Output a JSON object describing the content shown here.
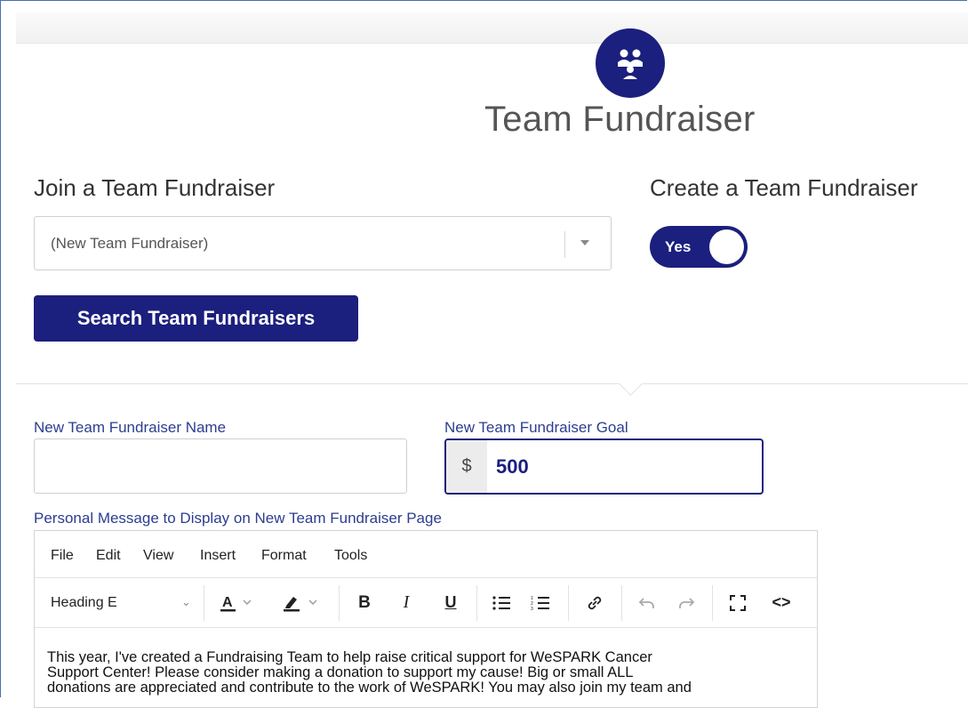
{
  "page": {
    "title": "Team Fundraiser",
    "icon": "team-icon"
  },
  "join": {
    "heading": "Join a Team Fundraiser",
    "select_value": "(New Team Fundraiser)",
    "search_button": "Search Team Fundraisers"
  },
  "create": {
    "heading": "Create a Team Fundraiser",
    "toggle_label": "Yes",
    "toggle_on": true
  },
  "form": {
    "name_label": "New Team Fundraiser Name",
    "name_value": "",
    "goal_label": "New Team Fundraiser Goal",
    "goal_prefix": "$",
    "goal_value": "500",
    "message_label": "Personal Message to Display on New Team Fundraiser Page"
  },
  "editor": {
    "menu": [
      "File",
      "Edit",
      "View",
      "Insert",
      "Format",
      "Tools"
    ],
    "format_select": "Heading E",
    "content_lines": [
      "This year, I've created a Fundraising Team to help raise critical support for WeSPARK Cancer",
      "Support Center! Please consider making a donation to support my cause! Big or small ALL",
      "donations are appreciated and contribute to the work of WeSPARK! You may also join my team and"
    ]
  },
  "colors": {
    "accent": "#1b1f7d",
    "label": "#2c3d8f"
  }
}
